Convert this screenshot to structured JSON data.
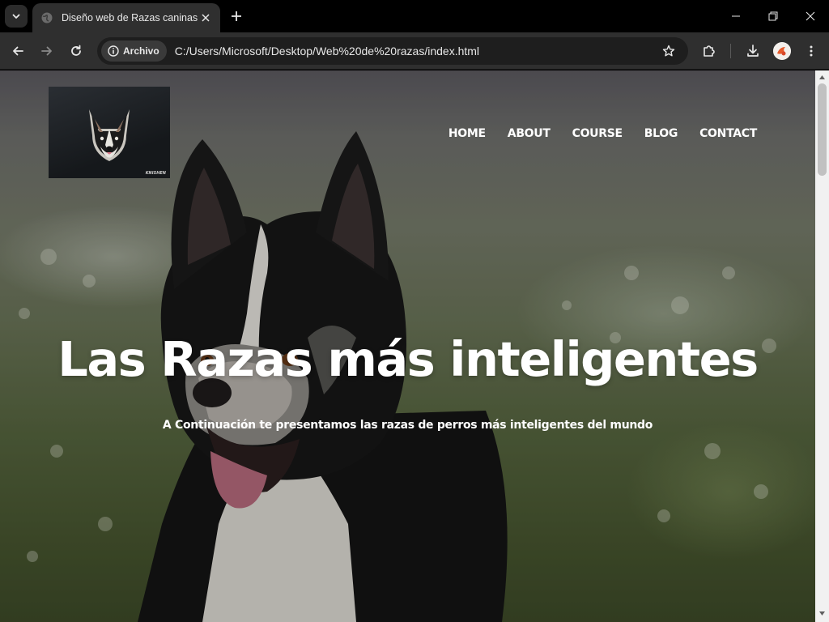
{
  "browser": {
    "tab": {
      "title": "Diseño web de Razas caninas"
    },
    "address": {
      "site_chip": "Archivo",
      "url": "C:/Users/Microsoft/Desktop/Web%20de%20razas/index.html"
    },
    "icons": {
      "tab_search": "chevron-down-icon",
      "favicon": "globe-icon",
      "tab_close": "close-icon",
      "new_tab": "plus-icon",
      "minimize": "minimize-icon",
      "maximize": "restore-icon",
      "close_window": "close-icon",
      "back": "arrow-left-icon",
      "forward": "arrow-right-icon",
      "reload": "reload-icon",
      "site_info": "info-icon",
      "bookmark": "star-icon",
      "extensions": "puzzle-icon",
      "downloads": "download-icon",
      "profile": "avatar",
      "menu": "more-vertical-icon"
    }
  },
  "page": {
    "logo": {
      "signature": "KNISHEN"
    },
    "nav": [
      "HOME",
      "ABOUT",
      "COURSE",
      "BLOG",
      "CONTACT"
    ],
    "hero": {
      "title": "Las Razas más inteligentes",
      "subtitle": "A Continuación te presentamos las razas de perros más inteligentes del mundo"
    }
  },
  "colors": {
    "chrome_dark": "#000000",
    "toolbar": "#2f2f2f",
    "omnibox": "#1e1e1e",
    "text_white": "#ffffff"
  }
}
